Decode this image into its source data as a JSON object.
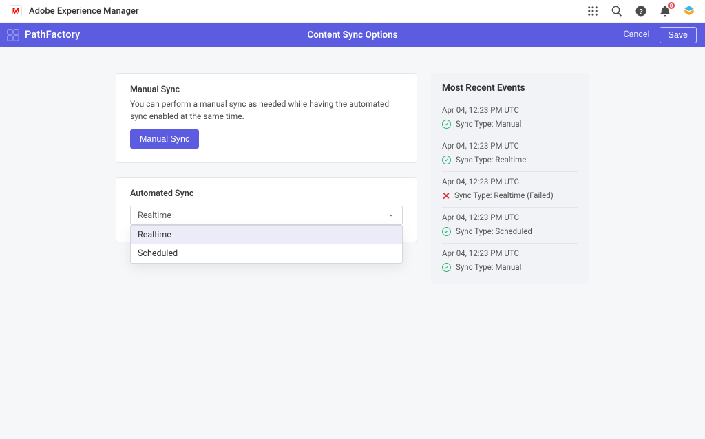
{
  "aem": {
    "title": "Adobe Experience Manager",
    "notification_count": "0"
  },
  "pf": {
    "brand": "PathFactory",
    "title": "Content Sync Options",
    "cancel": "Cancel",
    "save": "Save"
  },
  "manual_sync": {
    "heading": "Manual Sync",
    "description": "You can perform a manual sync as needed while having the automated sync enabled at the same time.",
    "button": "Manual Sync"
  },
  "auto_sync": {
    "heading": "Automated Sync",
    "selected": "Realtime",
    "options": [
      "Realtime",
      "Scheduled"
    ]
  },
  "events": {
    "heading": "Most Recent Events",
    "items": [
      {
        "time": "Apr 04, 12:23 PM UTC",
        "label": "Sync Type: Manual",
        "status": "ok"
      },
      {
        "time": "Apr 04, 12:23 PM UTC",
        "label": "Sync Type: Realtime",
        "status": "ok"
      },
      {
        "time": "Apr 04, 12:23 PM UTC",
        "label": "Sync Type: Realtime (Failed)",
        "status": "fail"
      },
      {
        "time": "Apr 04, 12:23 PM UTC",
        "label": "Sync Type: Scheduled",
        "status": "ok"
      },
      {
        "time": "Apr 04, 12:23 PM UTC",
        "label": "Sync Type: Manual",
        "status": "ok"
      }
    ]
  }
}
